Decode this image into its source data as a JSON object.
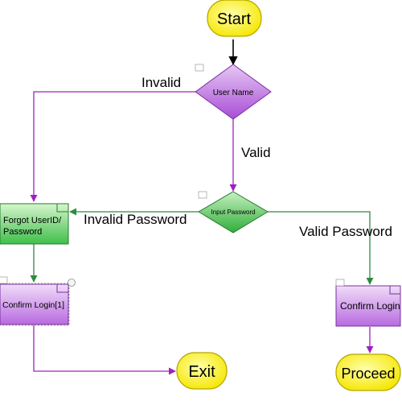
{
  "nodes": {
    "start": "Start",
    "username": "User Name",
    "input_password": "Input Password",
    "forgot": [
      "Forgot UserID/",
      "Password"
    ],
    "confirm_login_1": "Confirm Login[1]",
    "confirm_login": "Confirm Login",
    "exit": "Exit",
    "proceed": "Proceed"
  },
  "edges": {
    "invalid": "Invalid",
    "valid": "Valid",
    "invalid_password": "Invalid Password",
    "valid_password": "Valid Password"
  }
}
